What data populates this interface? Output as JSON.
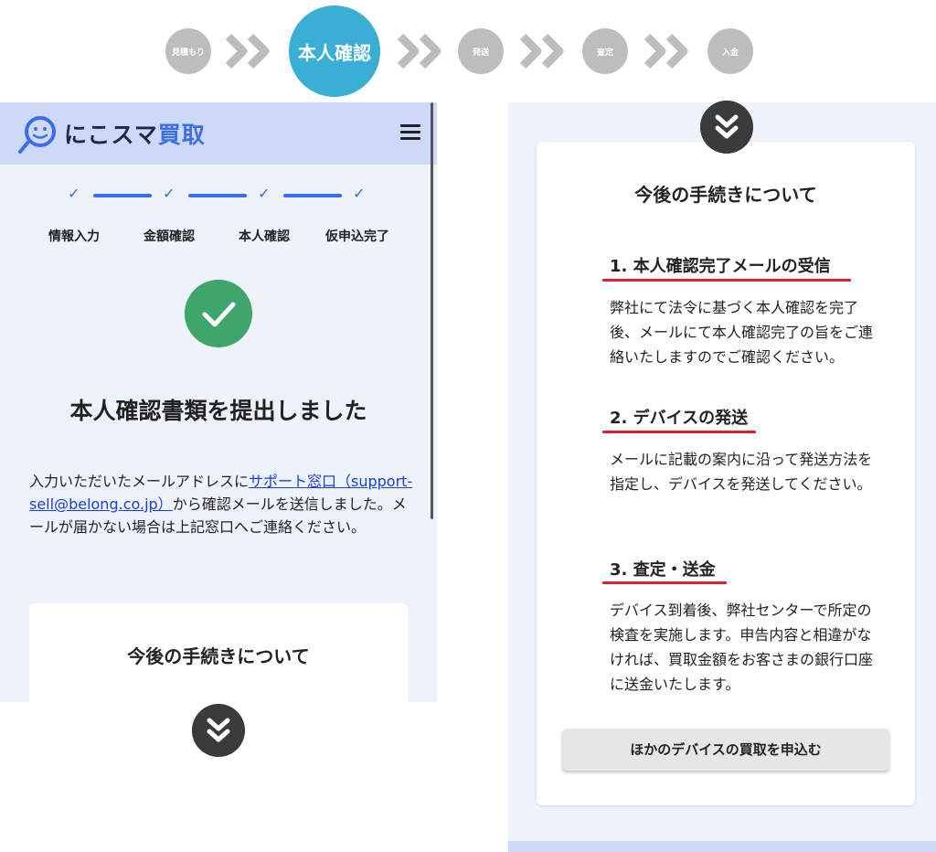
{
  "top_steps": {
    "steps": [
      "見積もり",
      "本人確認",
      "発送",
      "査定",
      "入金"
    ],
    "active_index": 1,
    "active_color": "#3aafd6",
    "inactive_color": "#bdbdbd"
  },
  "phone": {
    "logo": {
      "text_main": "にこスマ",
      "text_accent": "買取",
      "accent_color": "#3b6ee8"
    },
    "menu_icon": "hamburger-menu-icon",
    "progress": {
      "labels": [
        "情報入力",
        "金額確認",
        "本人確認",
        "仮申込完了"
      ],
      "completed": 4
    },
    "success_icon": "check-circle-icon",
    "title": "本人確認書類を提出しました",
    "message": {
      "before": "入力いただいたメールアドレスに",
      "link": "サポート窓口（support-sell@belong.co.jp）",
      "after": "から確認メールを送信しました。メールが届かない場合は上記窓口へご連絡ください。"
    },
    "card_title": "今後の手続きについて"
  },
  "right_panel": {
    "card_title": "今後の手続きについて",
    "sections": [
      {
        "title": "1. 本人確認完了メールの受信",
        "body": "弊社にて法令に基づく本人確認を完了後、メールにて本人確認完了の旨をご連絡いたしますのでご確認ください。"
      },
      {
        "title": "2. デバイスの発送",
        "body": "メールに記載の案内に沿って発送方法を指定し、デバイスを発送してください。"
      },
      {
        "title": "3. 査定・送金",
        "body": "デバイス到着後、弊社センターで所定の検査を実施します。申告内容と相違がなければ、買取金額をお客さまの銀行口座に送金いたします。"
      }
    ],
    "button_label": "ほかのデバイスの買取を申込む",
    "underline_color": "#e0202f"
  }
}
